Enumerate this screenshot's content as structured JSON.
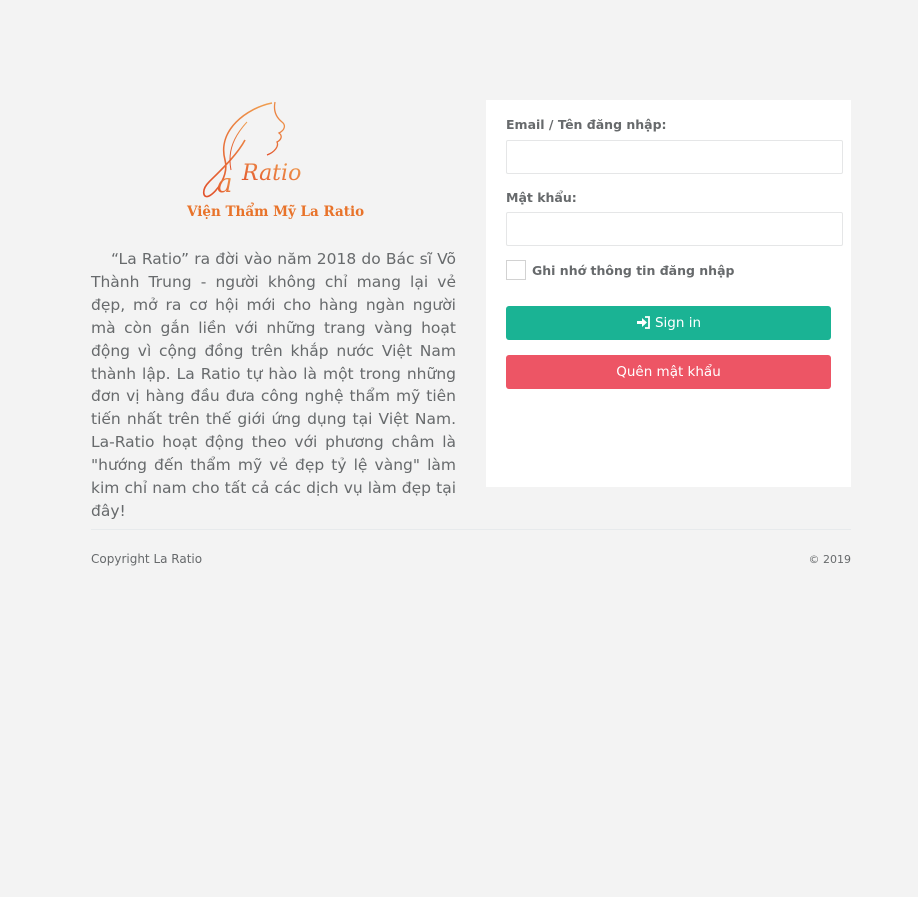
{
  "brand": {
    "logo_text": "La Ratio",
    "institute_name": "Viện Thẩm Mỹ La Ratio"
  },
  "intro": {
    "text": "“La Ratio” ra đời vào năm 2018 do Bác sĩ Võ Thành Trung - người không chỉ mang lại vẻ đẹp, mở ra cơ hội mới cho hàng ngàn người mà còn gắn liền với những trang vàng hoạt động vì cộng đồng trên khắp nước Việt Nam thành lập. La Ratio tự hào là một trong những đơn vị hàng đầu đưa công nghệ thẩm mỹ tiên tiến nhất trên thế giới ứng dụng tại Việt Nam. La-Ratio hoạt động theo với phương châm là \"hướng đến thẩm mỹ vẻ đẹp tỷ lệ vàng\" làm kim chỉ nam cho tất cả các dịch vụ làm đẹp tại đây!"
  },
  "login": {
    "email_label": "Email / Tên đăng nhập:",
    "email_value": "",
    "password_label": "Mật khẩu:",
    "password_value": "",
    "remember_label": "Ghi nhớ thông tin đăng nhập",
    "signin_label": "Sign in",
    "forgot_label": "Quên mật khẩu"
  },
  "footer": {
    "copyright": "Copyright La Ratio",
    "year": "© 2019"
  },
  "colors": {
    "background": "#f3f3f3",
    "primary": "#1ab394",
    "danger": "#ed5565",
    "brand_orange": "#e8732a"
  },
  "icons": {
    "signin": "sign-in-icon"
  }
}
